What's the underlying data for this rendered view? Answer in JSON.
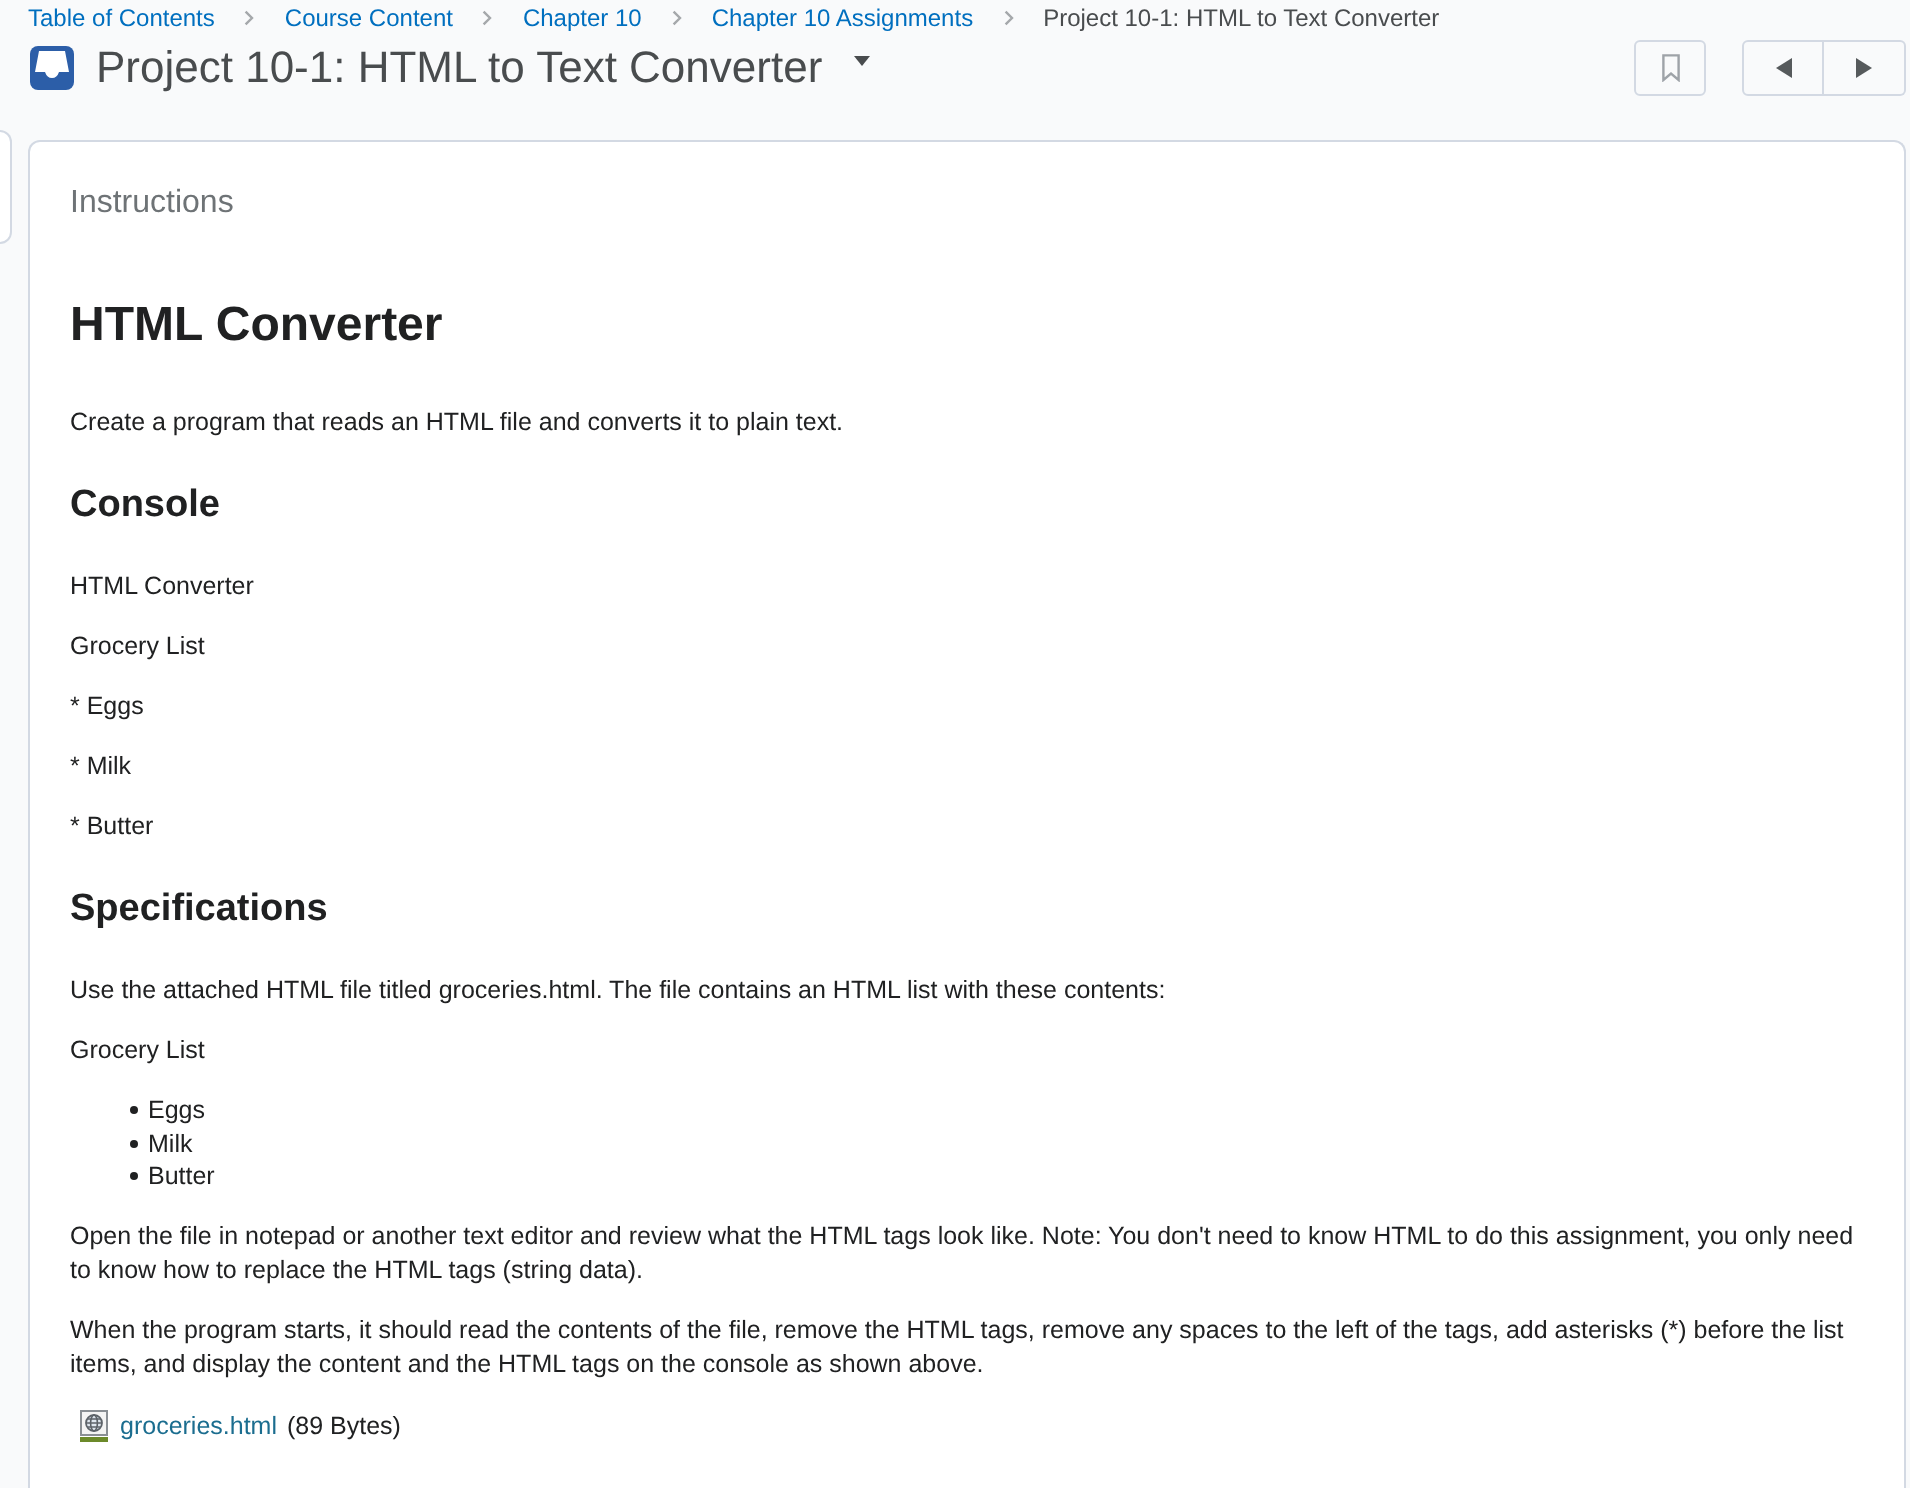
{
  "breadcrumbs": [
    {
      "label": "Table of Contents",
      "current": false
    },
    {
      "label": "Course Content",
      "current": false
    },
    {
      "label": "Chapter 10",
      "current": false
    },
    {
      "label": "Chapter 10 Assignments",
      "current": false
    },
    {
      "label": "Project 10-1: HTML to Text Converter",
      "current": true
    }
  ],
  "header": {
    "title": "Project 10-1: HTML to Text Converter"
  },
  "panel": {
    "heading": "Instructions",
    "content": [
      {
        "kind": "h2",
        "text": "HTML Converter"
      },
      {
        "kind": "p",
        "text": "Create a program that reads an HTML file and converts it to plain text."
      },
      {
        "kind": "h3",
        "text": "Console"
      },
      {
        "kind": "p",
        "text": "HTML Converter"
      },
      {
        "kind": "p",
        "text": "Grocery List"
      },
      {
        "kind": "p",
        "text": "* Eggs"
      },
      {
        "kind": "p",
        "text": "* Milk"
      },
      {
        "kind": "p",
        "text": "* Butter"
      },
      {
        "kind": "h3",
        "text": "Specifications"
      },
      {
        "kind": "p",
        "text": "Use the attached HTML file titled groceries.html. The file contains an HTML list with these contents:"
      },
      {
        "kind": "p",
        "text": "Grocery List"
      },
      {
        "kind": "bullets",
        "items": [
          "Eggs",
          "Milk",
          "Butter"
        ]
      },
      {
        "kind": "p",
        "text": "Open the file in notepad or another text editor and review what the HTML tags look like. Note: You don't need to know HTML to do this assignment, you only need to know how to replace the HTML tags (string data)."
      },
      {
        "kind": "p",
        "text": "When the program starts, it should read the contents of the file, remove the HTML tags, remove any spaces to the left of the tags, add asterisks (*) before the list items, and display the content and the HTML tags on the console as shown above."
      },
      {
        "kind": "attachment",
        "name": "groceries.html",
        "size": "(89 Bytes)"
      }
    ]
  }
}
